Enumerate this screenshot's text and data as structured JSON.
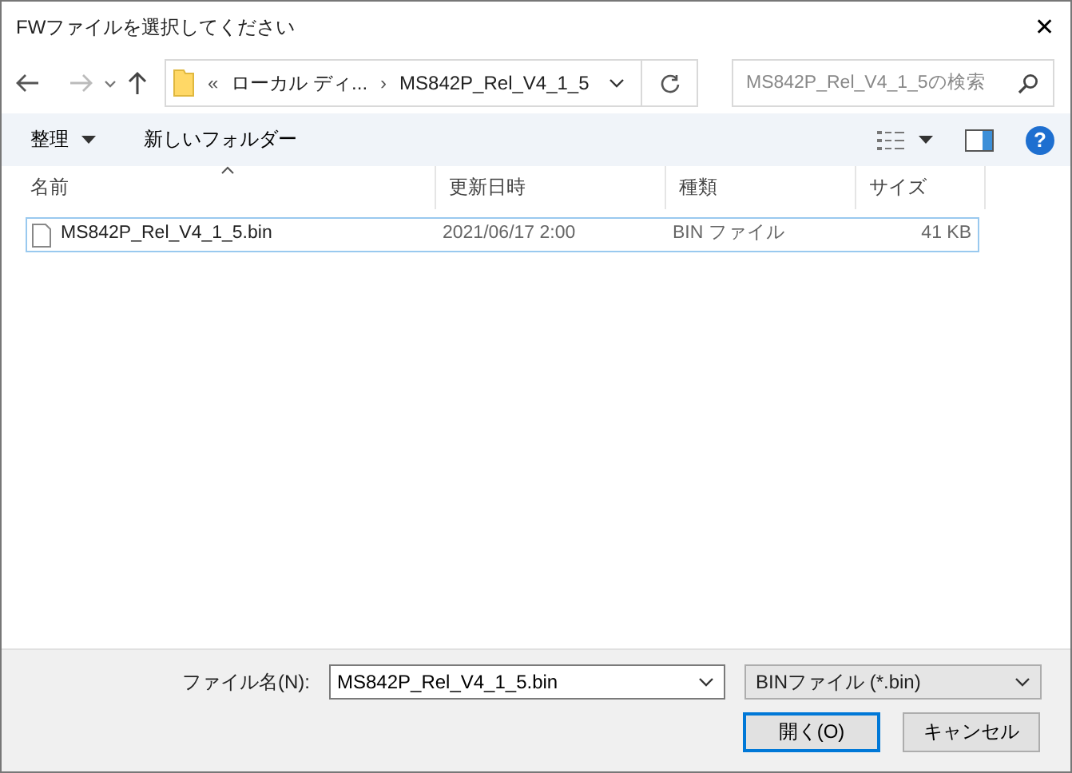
{
  "window": {
    "title": "FWファイルを選択してください",
    "close": "✕"
  },
  "address": {
    "overflow": "«",
    "crumbs": [
      "ローカル ディ...",
      "MS842P_Rel_V4_1_5"
    ],
    "separator": "›"
  },
  "search": {
    "placeholder": "MS842P_Rel_V4_1_5の検索"
  },
  "toolbar": {
    "organize": "整理",
    "new_folder": "新しいフォルダー",
    "help": "?"
  },
  "table": {
    "columns": [
      "名前",
      "更新日時",
      "種類",
      "サイズ"
    ],
    "rows": [
      {
        "name": "MS842P_Rel_V4_1_5.bin",
        "date": "2021/06/17 2:00",
        "type": "BIN ファイル",
        "size": "41 KB",
        "selected": true
      }
    ]
  },
  "footer": {
    "filename_label": "ファイル名(N):",
    "filename": "MS842P_Rel_V4_1_5.bin",
    "filter": "BINファイル (*.bin)",
    "open": "開く(O)",
    "cancel": "キャンセル"
  }
}
